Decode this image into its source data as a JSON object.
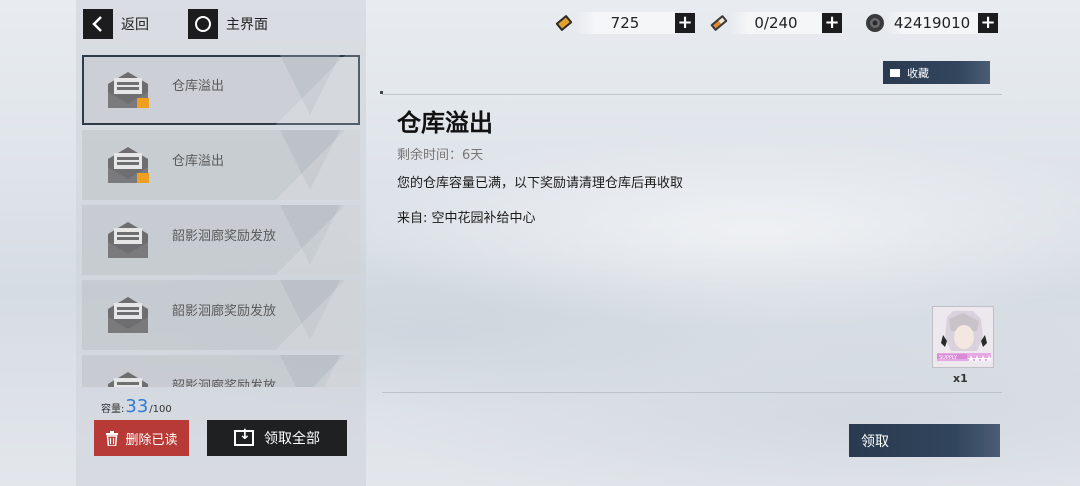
{
  "nav": {
    "back_label": "返回",
    "home_label": "主界面"
  },
  "resources": [
    {
      "name": "stamina-ticket",
      "value": "725",
      "icon": "gold-ticket-icon"
    },
    {
      "name": "energy-cell",
      "value": "0/240",
      "icon": "battery-icon"
    },
    {
      "name": "coins",
      "value": "42419010",
      "icon": "coin-icon"
    }
  ],
  "mail_list": [
    {
      "title": "仓库溢出",
      "has_attachment_badge": true,
      "selected": true
    },
    {
      "title": "仓库溢出",
      "has_attachment_badge": true,
      "selected": false
    },
    {
      "title": "韶影洄廊奖励发放",
      "has_attachment_badge": false,
      "selected": false
    },
    {
      "title": "韶影洄廊奖励发放",
      "has_attachment_badge": false,
      "selected": false
    },
    {
      "title": "韶影洄廊奖励发放",
      "has_attachment_badge": false,
      "selected": false
    }
  ],
  "capacity": {
    "label": "容量:",
    "current": "33",
    "max": "/100"
  },
  "buttons": {
    "delete_read": "删除已读",
    "claim_all": "领取全部",
    "favorite": "收藏",
    "claim": "领取"
  },
  "detail": {
    "title": "仓库溢出",
    "time_remaining": "剩余时间：6天",
    "body": "您的仓库容量已满，以下奖励请清理仓库后再收取",
    "from": "来自: 空中花园补给中心"
  },
  "reward": {
    "count": "x1",
    "icon": "character-portrait-icon",
    "rarity_stars": 4
  },
  "colors": {
    "accent_blue": "#2f7ad6",
    "delete_red": "#b83a36",
    "dark_button": "#1f2022",
    "navy_button": "#2a3a4f",
    "attachment_orange": "#f0a020"
  }
}
